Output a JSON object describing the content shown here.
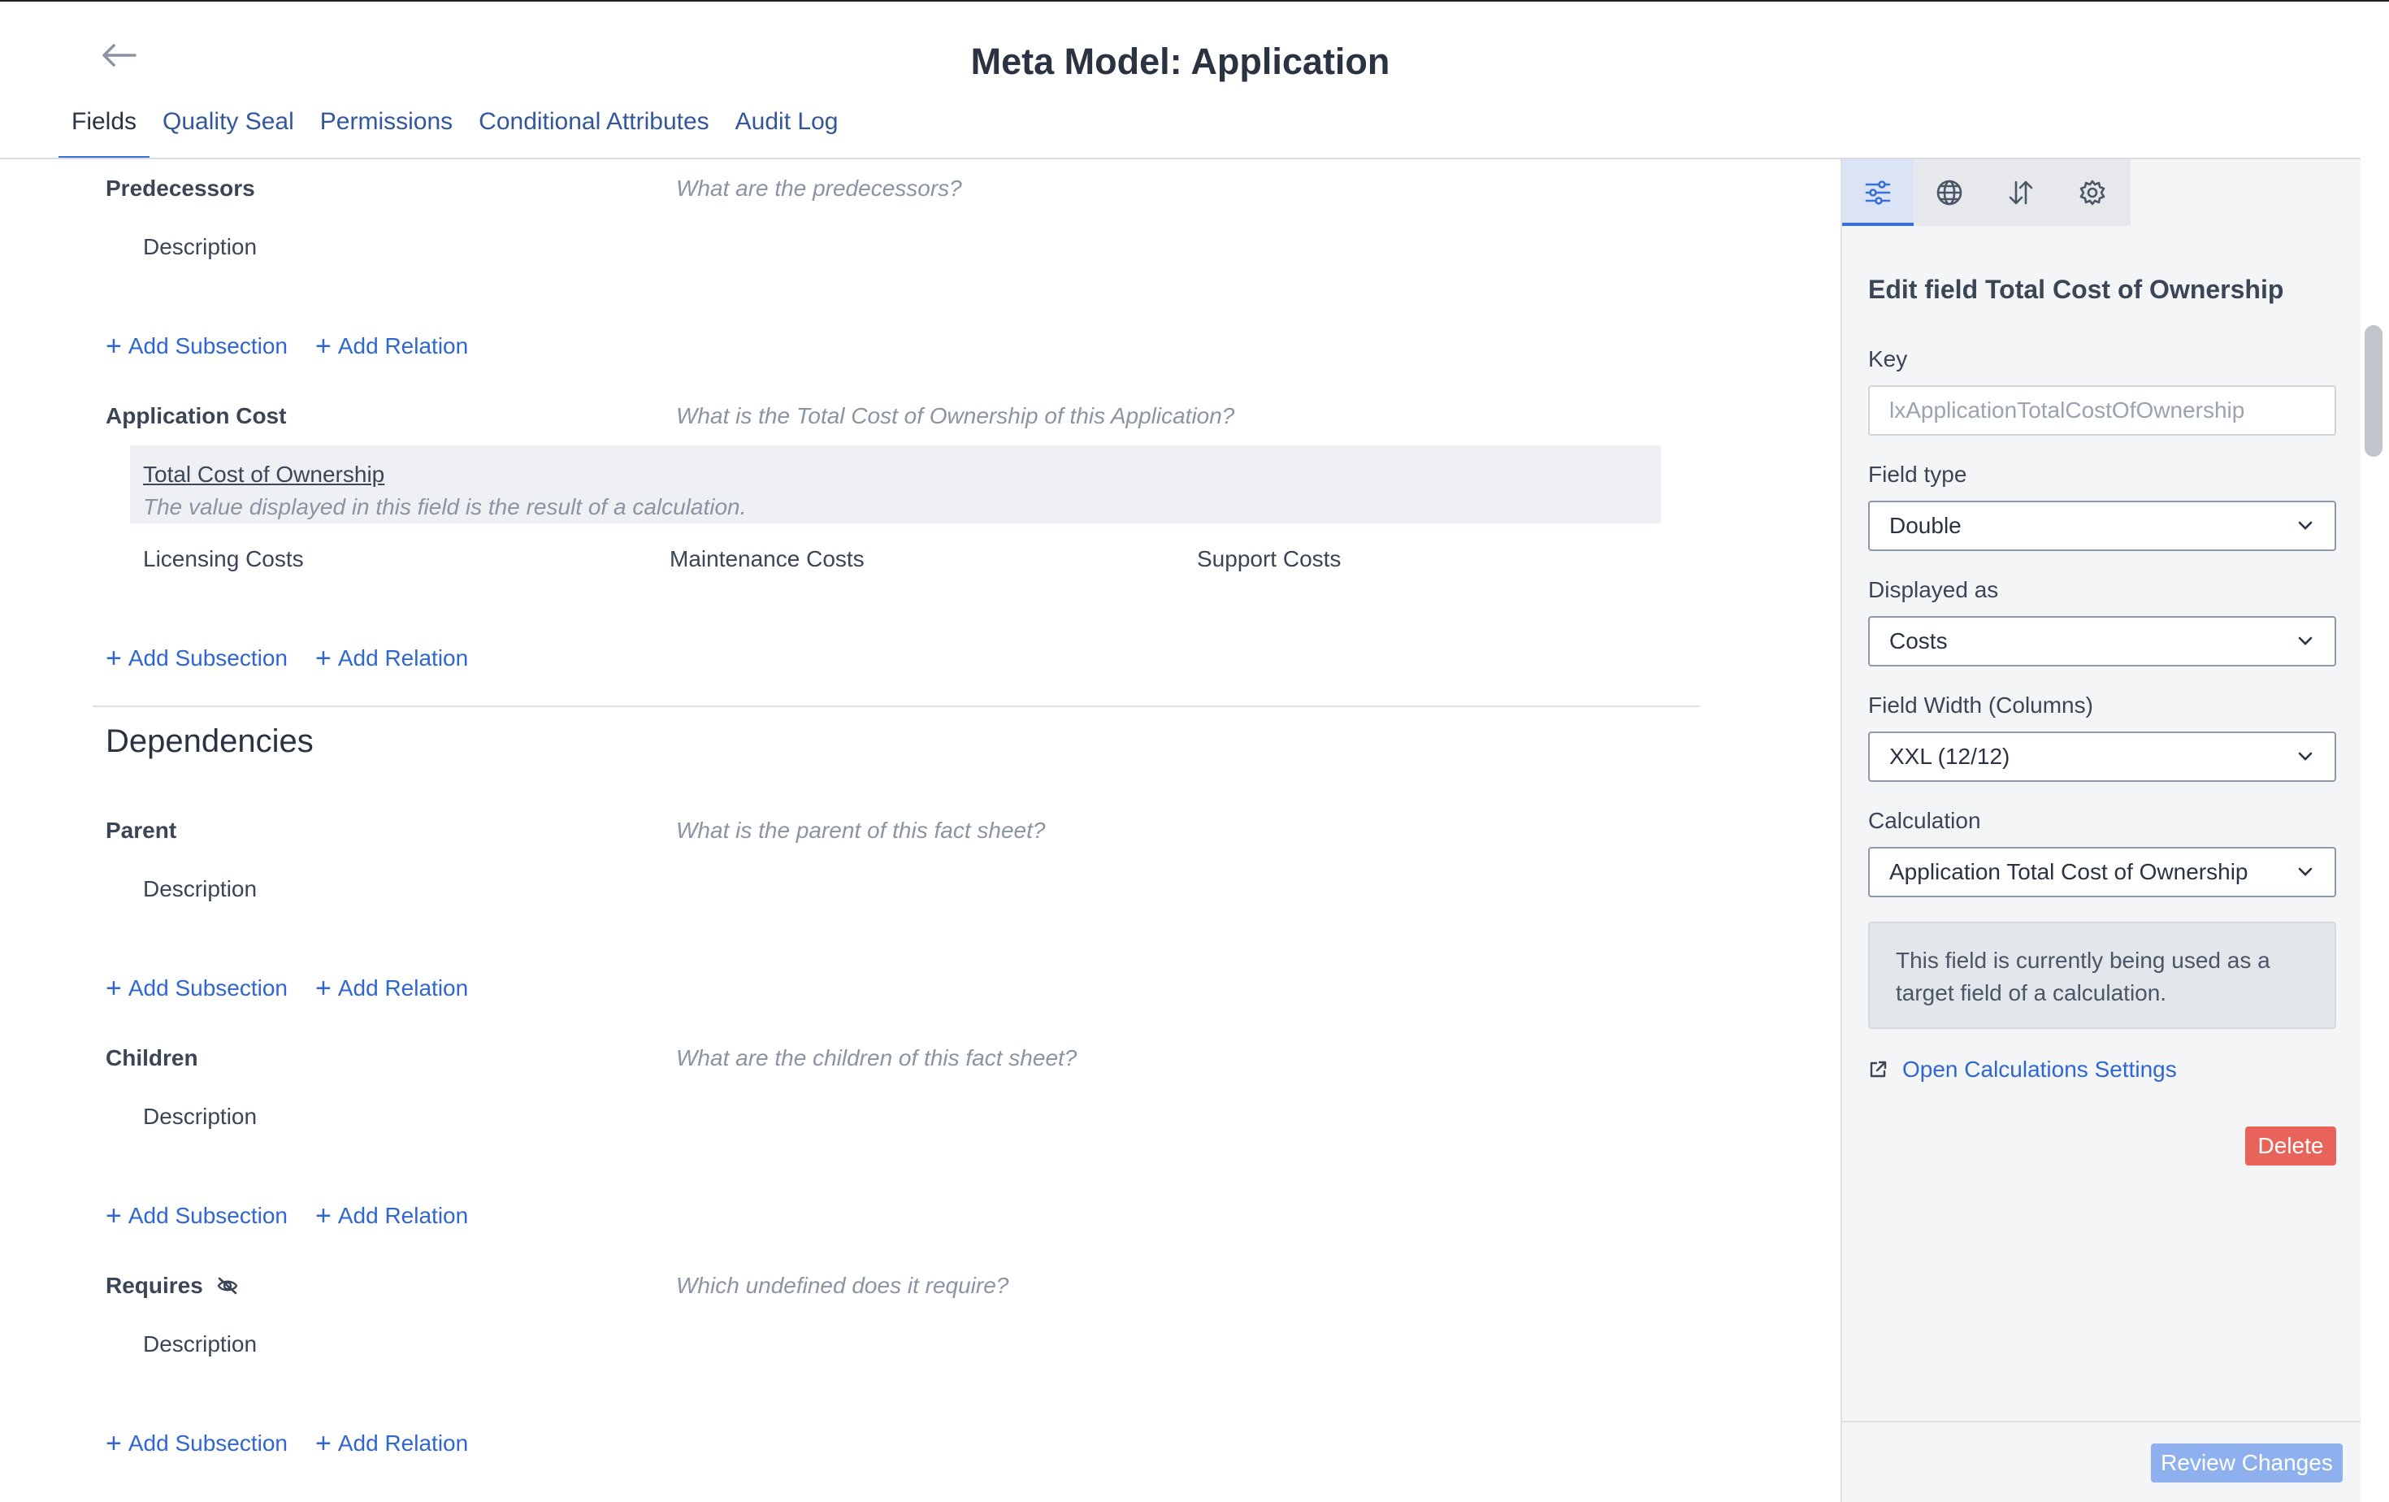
{
  "header": {
    "title": "Meta Model: Application",
    "back_icon": "arrow-left-icon"
  },
  "tabs": [
    {
      "label": "Fields",
      "active": true
    },
    {
      "label": "Quality Seal"
    },
    {
      "label": "Permissions"
    },
    {
      "label": "Conditional Attributes"
    },
    {
      "label": "Audit Log"
    }
  ],
  "main": {
    "add_subsection": "Add Subsection",
    "add_relation": "Add Relation",
    "predecessors": {
      "label": "Predecessors",
      "question": "What are the predecessors?",
      "field": "Description"
    },
    "application_cost": {
      "label": "Application Cost",
      "question": "What is the Total Cost of Ownership of this Application?",
      "tco_label": "Total Cost of Ownership",
      "tco_hint": "The value displayed in this field is the result of a calculation.",
      "fields": [
        "Licensing Costs",
        "Maintenance Costs",
        "Support Costs"
      ]
    },
    "dependencies_title": "Dependencies",
    "parent": {
      "label": "Parent",
      "question": "What is the parent of this fact sheet?",
      "field": "Description"
    },
    "children": {
      "label": "Children",
      "question": "What are the children of this fact sheet?",
      "field": "Description"
    },
    "requires": {
      "label": "Requires",
      "question": "Which undefined does it require?",
      "field": "Description",
      "icon": "eye-slash-icon"
    }
  },
  "panel": {
    "tab_icons": [
      "sliders-icon",
      "globe-icon",
      "sort-icon",
      "gear-icon"
    ],
    "title": "Edit field Total Cost of Ownership",
    "key_label": "Key",
    "key_value": "lxApplicationTotalCostOfOwnership",
    "field_type_label": "Field type",
    "field_type_value": "Double",
    "displayed_as_label": "Displayed as",
    "displayed_as_value": "Costs",
    "field_width_label": "Field Width (Columns)",
    "field_width_value": "XXL (12/12)",
    "calculation_label": "Calculation",
    "calculation_value": "Application Total Cost of Ownership",
    "info_text": "This field is currently being used as a target field of a calculation.",
    "calc_link": "Open Calculations Settings",
    "delete": "Delete",
    "review": "Review Changes"
  },
  "colors": {
    "accent": "#3a6fd8",
    "link": "#2f66d0",
    "delete": "#e8645a",
    "review": "#8fb0ee"
  }
}
